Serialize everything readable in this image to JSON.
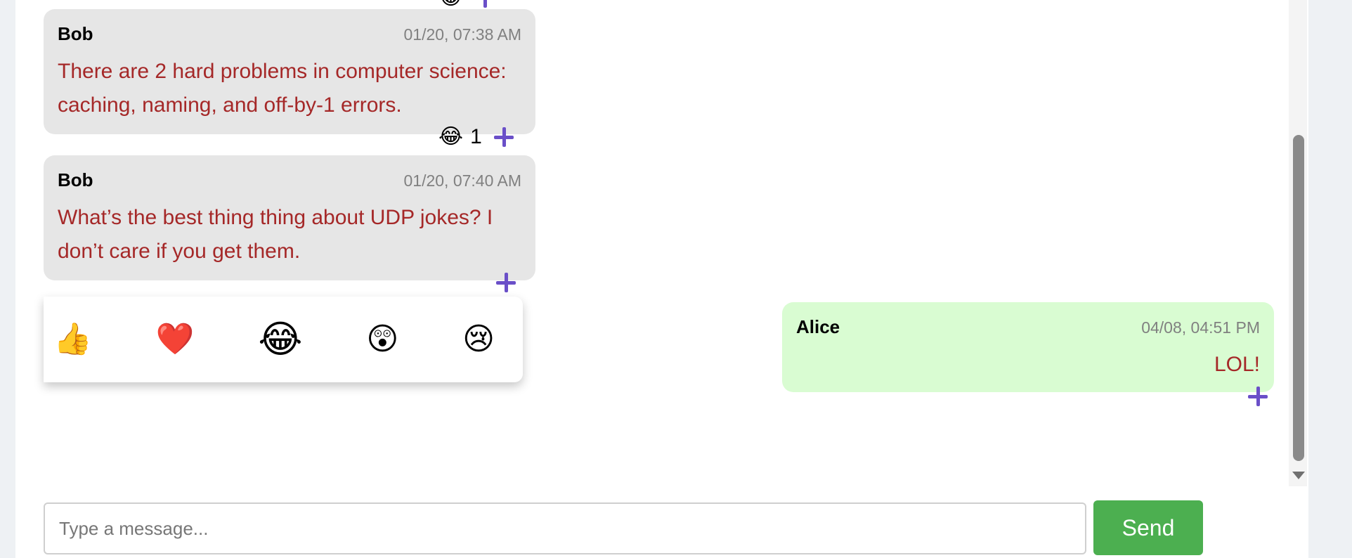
{
  "messages": [
    {
      "sender": "Bob",
      "time": "01/20, 07:38 AM",
      "text": "There are 2 hard problems in computer science: caching, naming, and off-by-1 errors.",
      "reactions": [
        {
          "emoji": "😂",
          "count": "1"
        }
      ]
    },
    {
      "sender": "Bob",
      "time": "01/20, 07:40 AM",
      "text": "What’s the best thing thing about UDP jokes? I don’t care if you get them.",
      "reactions": []
    },
    {
      "sender": "Alice",
      "time": "04/08, 04:51 PM",
      "text": "LOL!",
      "reactions": []
    }
  ],
  "top_partial_reaction": {
    "emoji": "😂"
  },
  "emoji_picker": [
    {
      "emoji": "👍",
      "icon": "thumbs-up-icon"
    },
    {
      "emoji": "❤️",
      "icon": "heart-icon"
    },
    {
      "emoji": "😂",
      "icon": "laughing-icon"
    },
    {
      "emoji": "😲",
      "icon": "surprised-icon"
    },
    {
      "emoji": "😢",
      "icon": "sad-icon"
    }
  ],
  "composer": {
    "placeholder": "Type a message...",
    "send_label": "Send"
  },
  "colors": {
    "received_bubble": "#e6e6e6",
    "sent_bubble": "#d9fcd2",
    "message_text": "#a52828",
    "accent_plus": "#6a4fc8",
    "send_button": "#4caf50"
  }
}
